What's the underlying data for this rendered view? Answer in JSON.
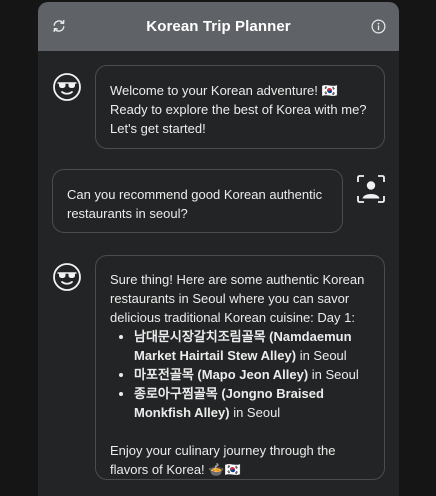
{
  "header": {
    "title": "Korean Trip Planner",
    "refresh_icon": "refresh-icon",
    "info_icon": "info-icon"
  },
  "messages": [
    {
      "role": "assistant",
      "avatar_icon": "cool-face-icon",
      "text": "Welcome to your Korean adventure! 🇰🇷 Ready to explore the best of Korea with me? Let's get started!"
    },
    {
      "role": "user",
      "avatar_icon": "user-portrait-icon",
      "text": "Can you recommend good Korean authentic restaurants in seoul?"
    },
    {
      "role": "assistant",
      "avatar_icon": "cool-face-icon",
      "intro": "Sure thing! Here are some authentic Korean restaurants in Seoul where you can savor delicious traditional Korean cuisine: Day 1:",
      "items": [
        {
          "name": "남대문시장갈치조림골목 (Namdaemun Market Hairtail Stew Alley)",
          "location": " in Seoul"
        },
        {
          "name": "마포전골목 (Mapo Jeon Alley)",
          "location": " in Seoul"
        },
        {
          "name": "종로아구찜골목 (Jongno Braised Monkfish Alley)",
          "location": " in Seoul"
        }
      ],
      "outro": "Enjoy your culinary journey through the flavors of Korea! 🍲🇰🇷"
    }
  ],
  "colors": {
    "background": "#151515",
    "window": "#232425",
    "titlebar": "#5f6367",
    "bubble_border": "#4a4c4f",
    "text": "#ececec"
  }
}
